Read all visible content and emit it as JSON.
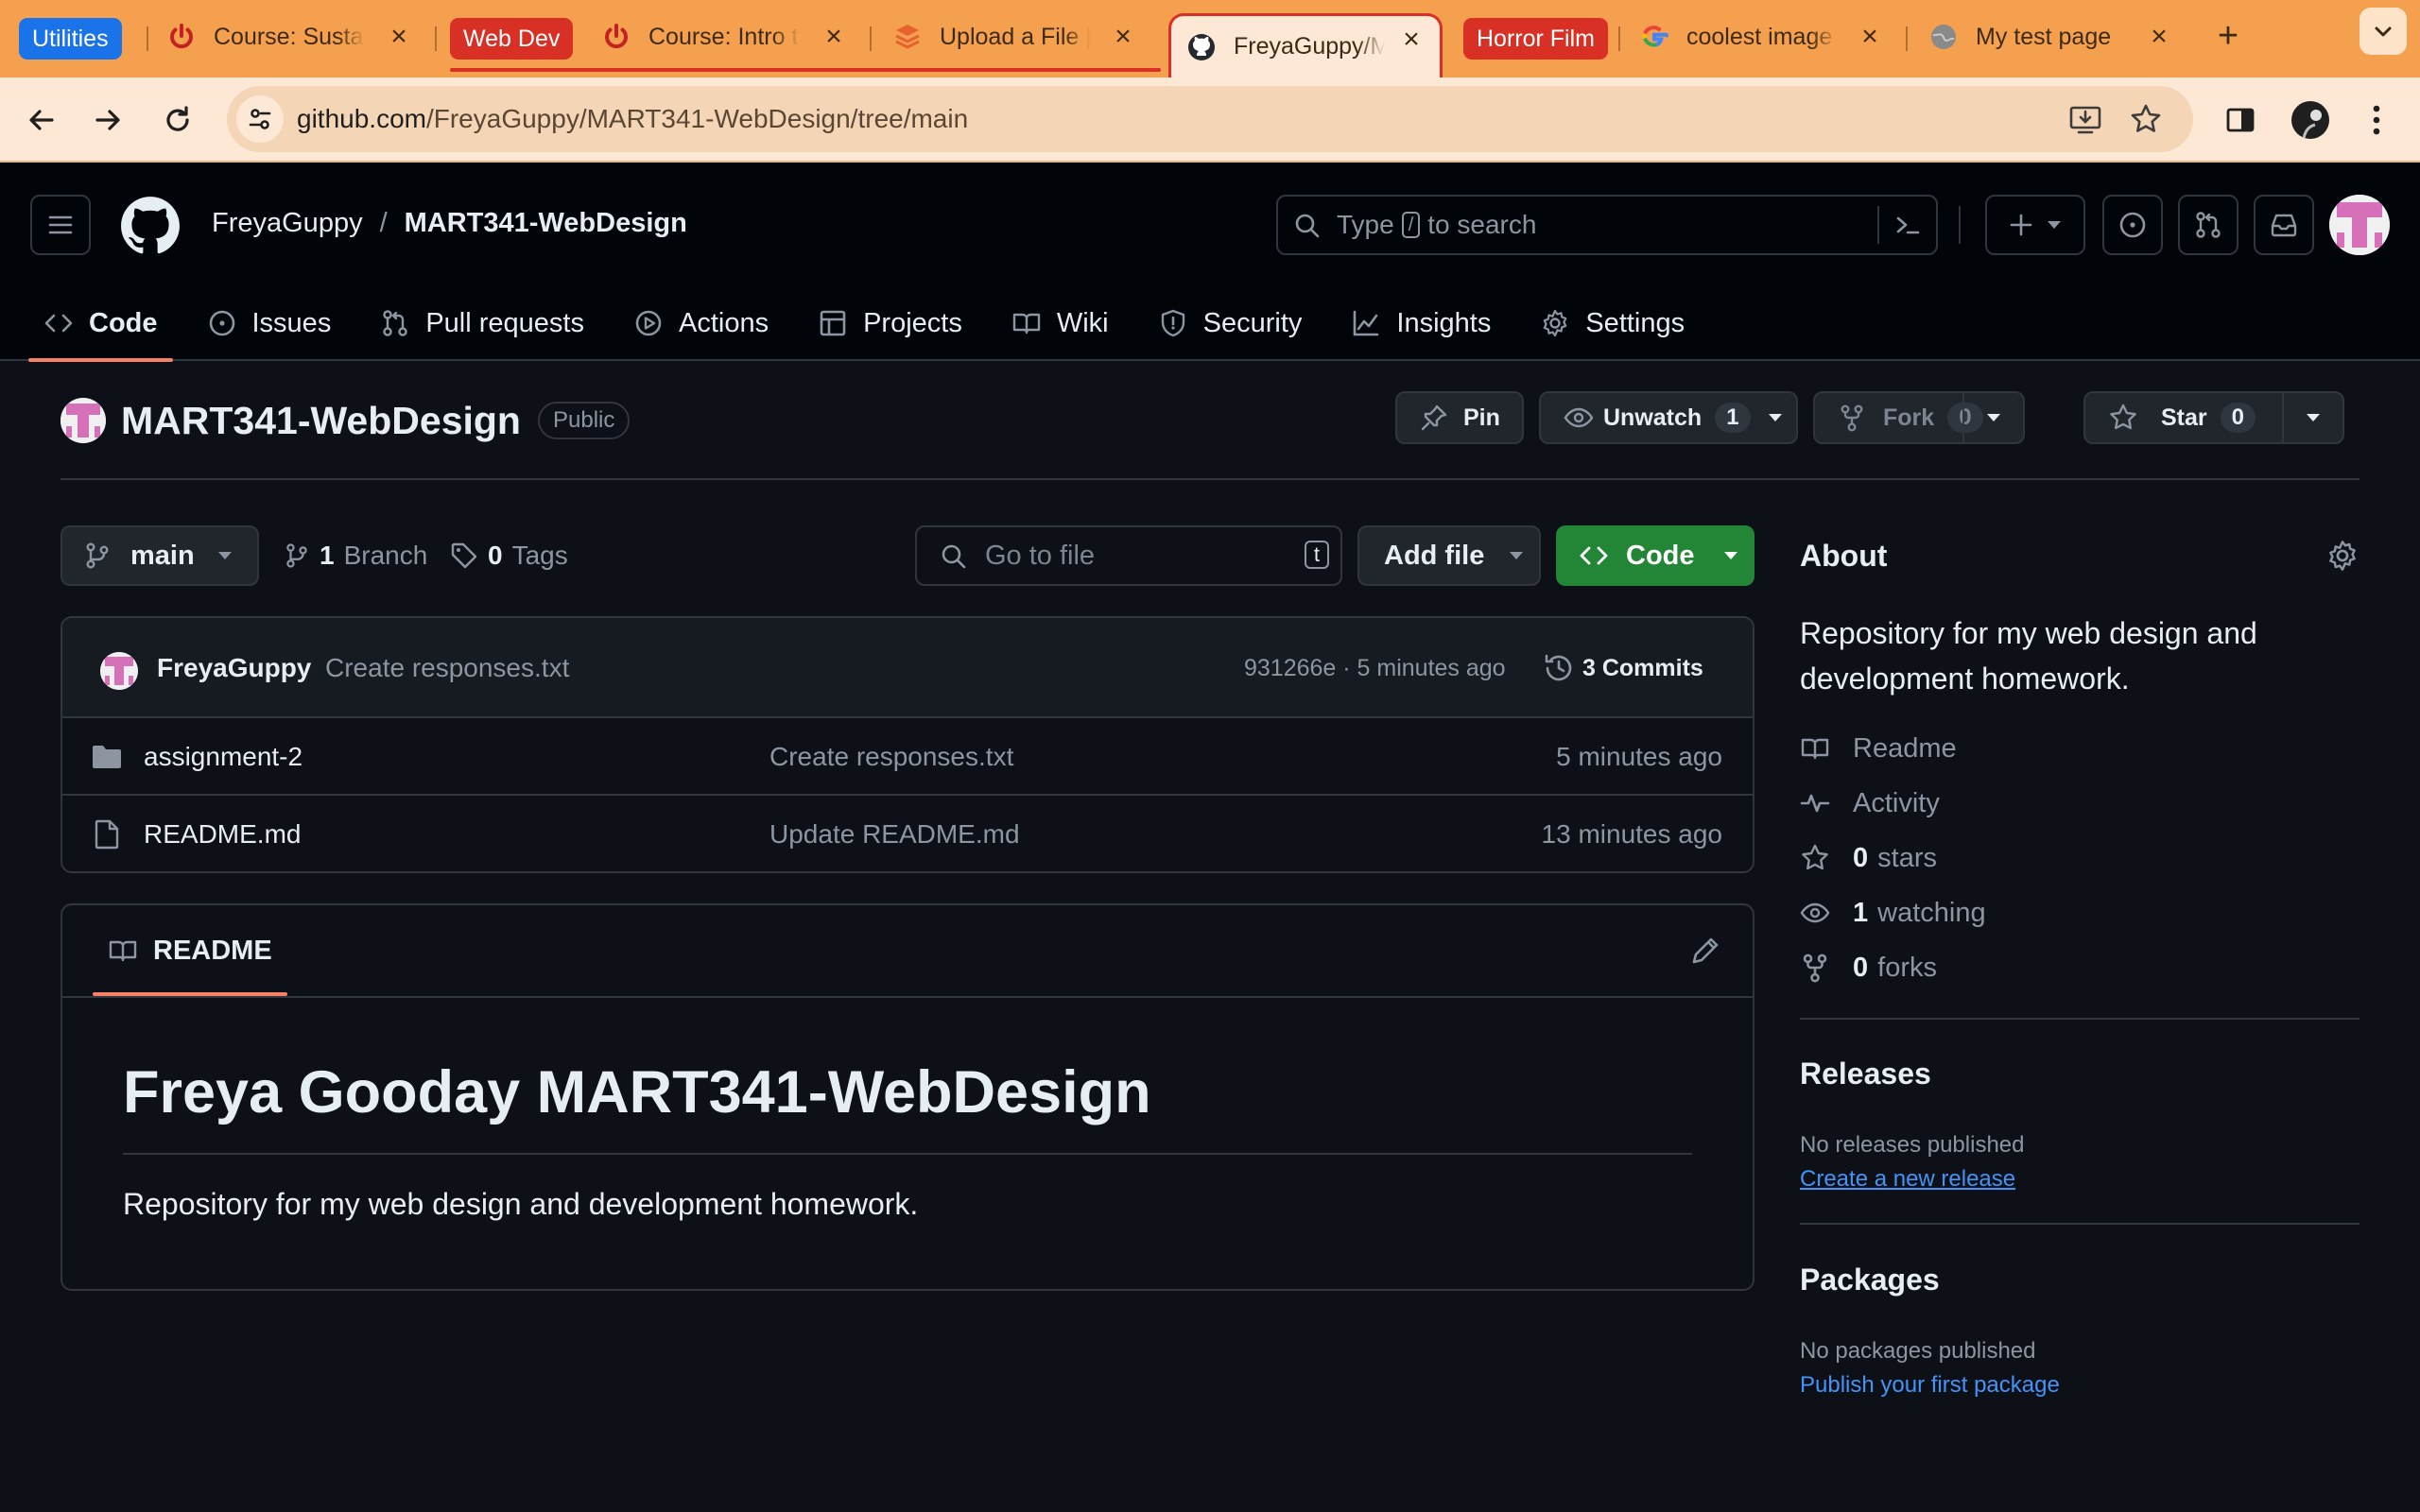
{
  "browser": {
    "tab_groups": [
      {
        "label": "Utilities",
        "color": "#1a73e8"
      },
      {
        "label": "Web Dev",
        "color": "#d93025"
      },
      {
        "label": "Horror Film",
        "color": "#d93025"
      }
    ],
    "tabs": [
      {
        "title": "Course: Sustai",
        "icon": "power-icon"
      },
      {
        "title": "Course: Intro t",
        "icon": "power-icon"
      },
      {
        "title": "Upload a File |",
        "icon": "layers-icon"
      },
      {
        "title": "FreyaGuppy/M",
        "icon": "github-icon",
        "active": true
      },
      {
        "title": "coolest image",
        "icon": "google-icon"
      },
      {
        "title": "My test page",
        "icon": "globe-icon"
      }
    ],
    "url_host": "github.com",
    "url_path": "/FreyaGuppy/MART341-WebDesign/tree/main"
  },
  "header": {
    "owner": "FreyaGuppy",
    "separator": "/",
    "repo": "MART341-WebDesign",
    "search_before": "Type",
    "search_key": "/",
    "search_after": "to search"
  },
  "repo_nav": [
    {
      "label": "Code",
      "icon": "code-icon",
      "active": true
    },
    {
      "label": "Issues",
      "icon": "issues-icon"
    },
    {
      "label": "Pull requests",
      "icon": "pull-request-icon"
    },
    {
      "label": "Actions",
      "icon": "actions-icon"
    },
    {
      "label": "Projects",
      "icon": "projects-icon"
    },
    {
      "label": "Wiki",
      "icon": "wiki-icon"
    },
    {
      "label": "Security",
      "icon": "shield-icon"
    },
    {
      "label": "Insights",
      "icon": "graph-icon"
    },
    {
      "label": "Settings",
      "icon": "gear-icon"
    }
  ],
  "repo": {
    "name": "MART341-WebDesign",
    "visibility": "Public",
    "pin_label": "Pin",
    "unwatch_label": "Unwatch",
    "watch_count": "1",
    "fork_label": "Fork",
    "fork_count": "0",
    "star_label": "Star",
    "star_count": "0"
  },
  "files_bar": {
    "branch": "main",
    "branch_count": "1",
    "branch_label": "Branch",
    "tag_count": "0",
    "tag_label": "Tags",
    "goto_placeholder": "Go to file",
    "goto_key": "t",
    "add_file_label": "Add file",
    "code_label": "Code"
  },
  "latest_commit": {
    "author": "FreyaGuppy",
    "message": "Create responses.txt",
    "sha_time": "931266e · 5 minutes ago",
    "commits_label": "3 Commits"
  },
  "files": [
    {
      "name": "assignment-2",
      "type": "folder",
      "message": "Create responses.txt",
      "age": "5 minutes ago"
    },
    {
      "name": "README.md",
      "type": "file",
      "message": "Update README.md",
      "age": "13 minutes ago"
    }
  ],
  "readme": {
    "tab_label": "README",
    "heading": "Freya Gooday MART341-WebDesign",
    "body": "Repository for my web design and development homework."
  },
  "about": {
    "title": "About",
    "description": "Repository for my web design and development homework.",
    "readme_label": "Readme",
    "activity_label": "Activity",
    "stars_count": "0",
    "stars_label": "stars",
    "watching_count": "1",
    "watching_label": "watching",
    "forks_count": "0",
    "forks_label": "forks"
  },
  "releases": {
    "title": "Releases",
    "empty_text": "No releases published",
    "link": "Create a new release"
  },
  "packages": {
    "title": "Packages",
    "empty_text": "No packages published",
    "link": "Publish your first package"
  },
  "colors": {
    "accent_green": "#238636",
    "link_blue": "#4493f8",
    "underline_orange": "#f78166",
    "chrome_orange": "#f5a04f"
  }
}
